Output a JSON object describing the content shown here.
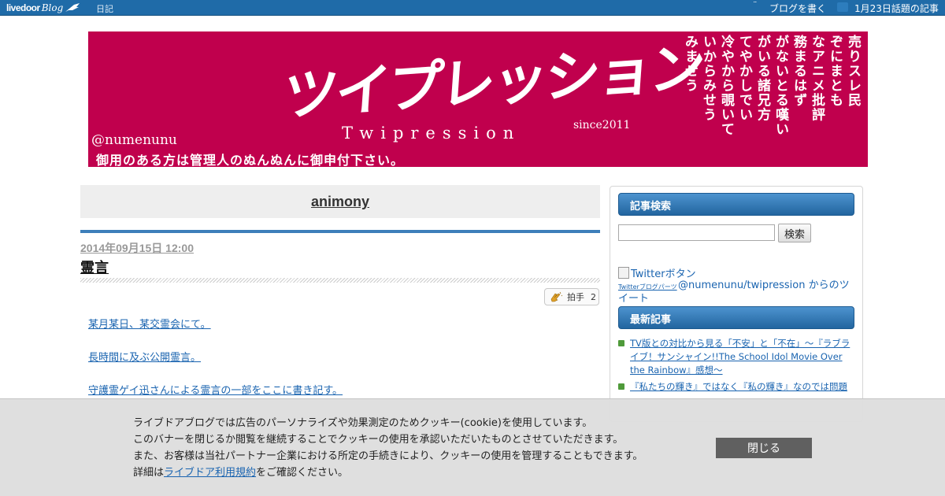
{
  "topbar": {
    "logo_main": "livedoor",
    "logo_sub": "Blog",
    "diary": "日記",
    "dots": "¨",
    "write_blog": "ブログを書く",
    "hot_topic": "1月23日話題の記事"
  },
  "banner": {
    "title": "ツイプレッション",
    "roman": "Twipression",
    "since": "since2011",
    "handle": "@numenunu",
    "message": "御用のある方は管理人のぬんぬんに御申付下さい。",
    "poem_columns": [
      "売りスレ民",
      "ぞにまとも",
      "なアニメ批評",
      "務まるはず",
      "がないとる嘆い",
      "がいる諸兄方",
      "てやかしでい",
      "冷やから覗いて",
      "いからみせう",
      "みませう"
    ]
  },
  "main": {
    "blog_title": "animony",
    "post": {
      "date": "2014年09月15日 12:00",
      "title": "霊言",
      "clap_label": "拍手",
      "clap_count": "2",
      "lines": [
        "某月某日、某交霊会にて。",
        "長時間に及ぶ公開霊言。",
        "守護霊ゲイ迅さんによる霊言の一部をここに書き記す。"
      ]
    }
  },
  "sidebar": {
    "search_heading": "記事検索",
    "search_value": "",
    "search_button": "検索",
    "twitter_button_alt": "Twitterボタン",
    "twitter_parts": "Twitterブログパーツ",
    "twitter_link": "@numenunu/twipression からのツイート",
    "recent_heading": "最新記事",
    "recent_items": [
      "TV版との対比から見る「不安」と「不在」～『ラブライブ！サンシャイン!!The School Idol Movie Over the Rainbow』感想～",
      "『私たちの輝き』ではなく『私の輝き』なのでは問題"
    ]
  },
  "cookie": {
    "line1": "ライブドアブログでは広告のパーソナライズや効果測定のためクッキー(cookie)を使用しています。",
    "line2": "このバナーを閉じるか閲覧を継続することでクッキーの使用を承認いただいたものとさせていただきます。",
    "line3": "また、お客様は当社パートナー企業における所定の手続きにより、クッキーの使用を管理することもできます。",
    "line4_prefix": "詳細は",
    "line4_link": "ライブドア利用規約",
    "line4_suffix": "をご確認ください。",
    "close_button": "閉じる"
  },
  "colors": {
    "topbar": "#1f6ba8",
    "banner": "#c0004d",
    "accent_rule": "#3d7fba",
    "link": "#1a64b0"
  }
}
